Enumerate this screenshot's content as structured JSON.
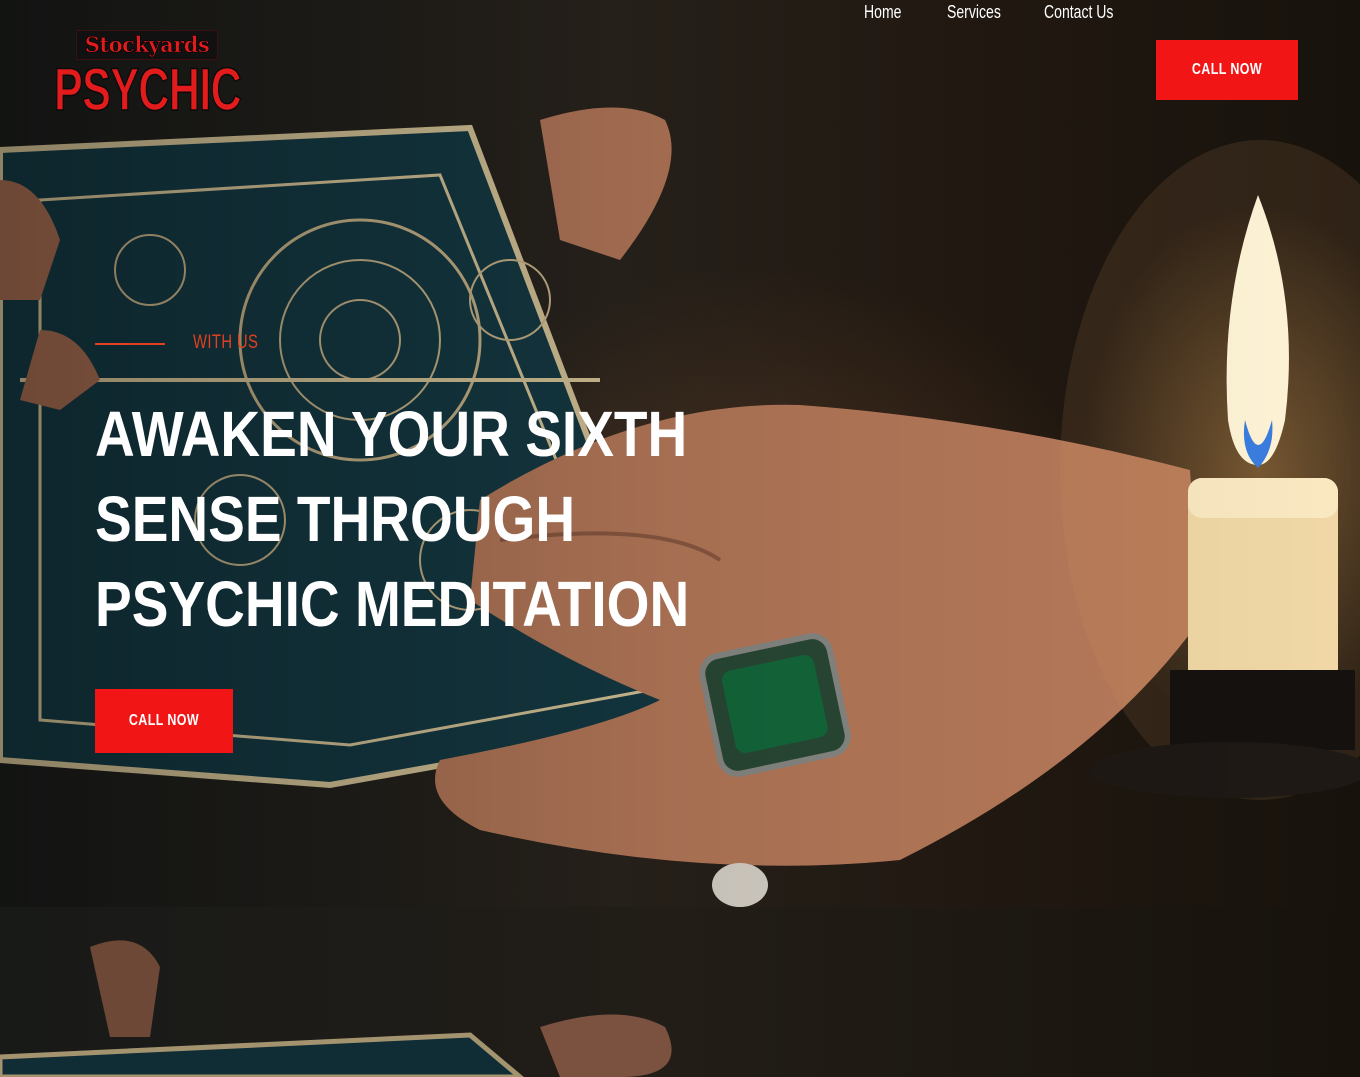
{
  "brand": {
    "logo_top": "Stockyards",
    "logo_main": "PSYCHIC",
    "color": "#e21c1c"
  },
  "nav": {
    "items": [
      {
        "label": "Home"
      },
      {
        "label": "Services"
      },
      {
        "label": "Contact Us"
      }
    ],
    "cta_label": "CALL NOW"
  },
  "hero": {
    "eyebrow": "WITH US",
    "headline_lines": [
      "AWAKEN YOUR SIXTH",
      "SENSE THROUGH",
      "PSYCHIC MEDITATION"
    ],
    "cta_label": "CALL NOW",
    "background_image": "hands holding tarot cards beside a lit candle"
  },
  "colors": {
    "accent": "#f11515",
    "eyebrow": "#e2401f",
    "text": "#ffffff"
  }
}
